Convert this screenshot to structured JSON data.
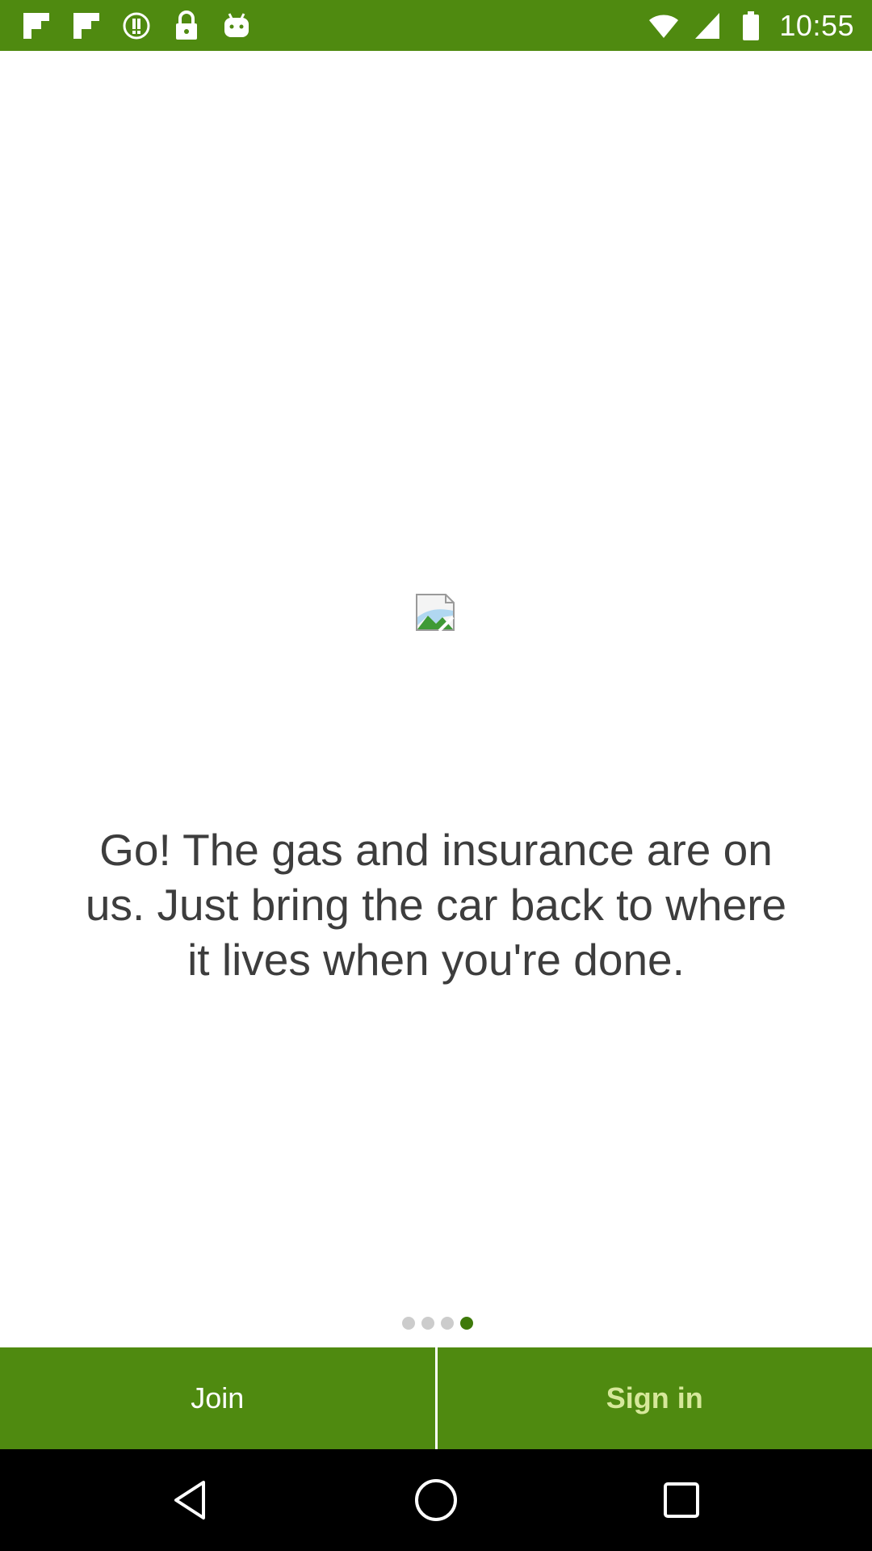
{
  "status_bar": {
    "time": "10:55",
    "left_icons": [
      "flipboard-icon",
      "flipboard-icon",
      "circle-exclamation-icon",
      "lock-icon",
      "android-icon"
    ],
    "right_icons": [
      "wifi-icon",
      "signal-icon",
      "battery-icon"
    ],
    "background": "#4f8a10"
  },
  "hero": {
    "image_icon": "broken-image-icon"
  },
  "message": {
    "text": "Go! The gas and insurance are on us. Just bring the car back to where it lives when you're done."
  },
  "pager": {
    "total": 4,
    "active_index": 3
  },
  "actions": {
    "join_label": "Join",
    "signin_label": "Sign in",
    "background": "#4f8a10"
  },
  "nav_bar": {
    "buttons": [
      "back-icon",
      "home-icon",
      "recent-apps-icon"
    ]
  }
}
